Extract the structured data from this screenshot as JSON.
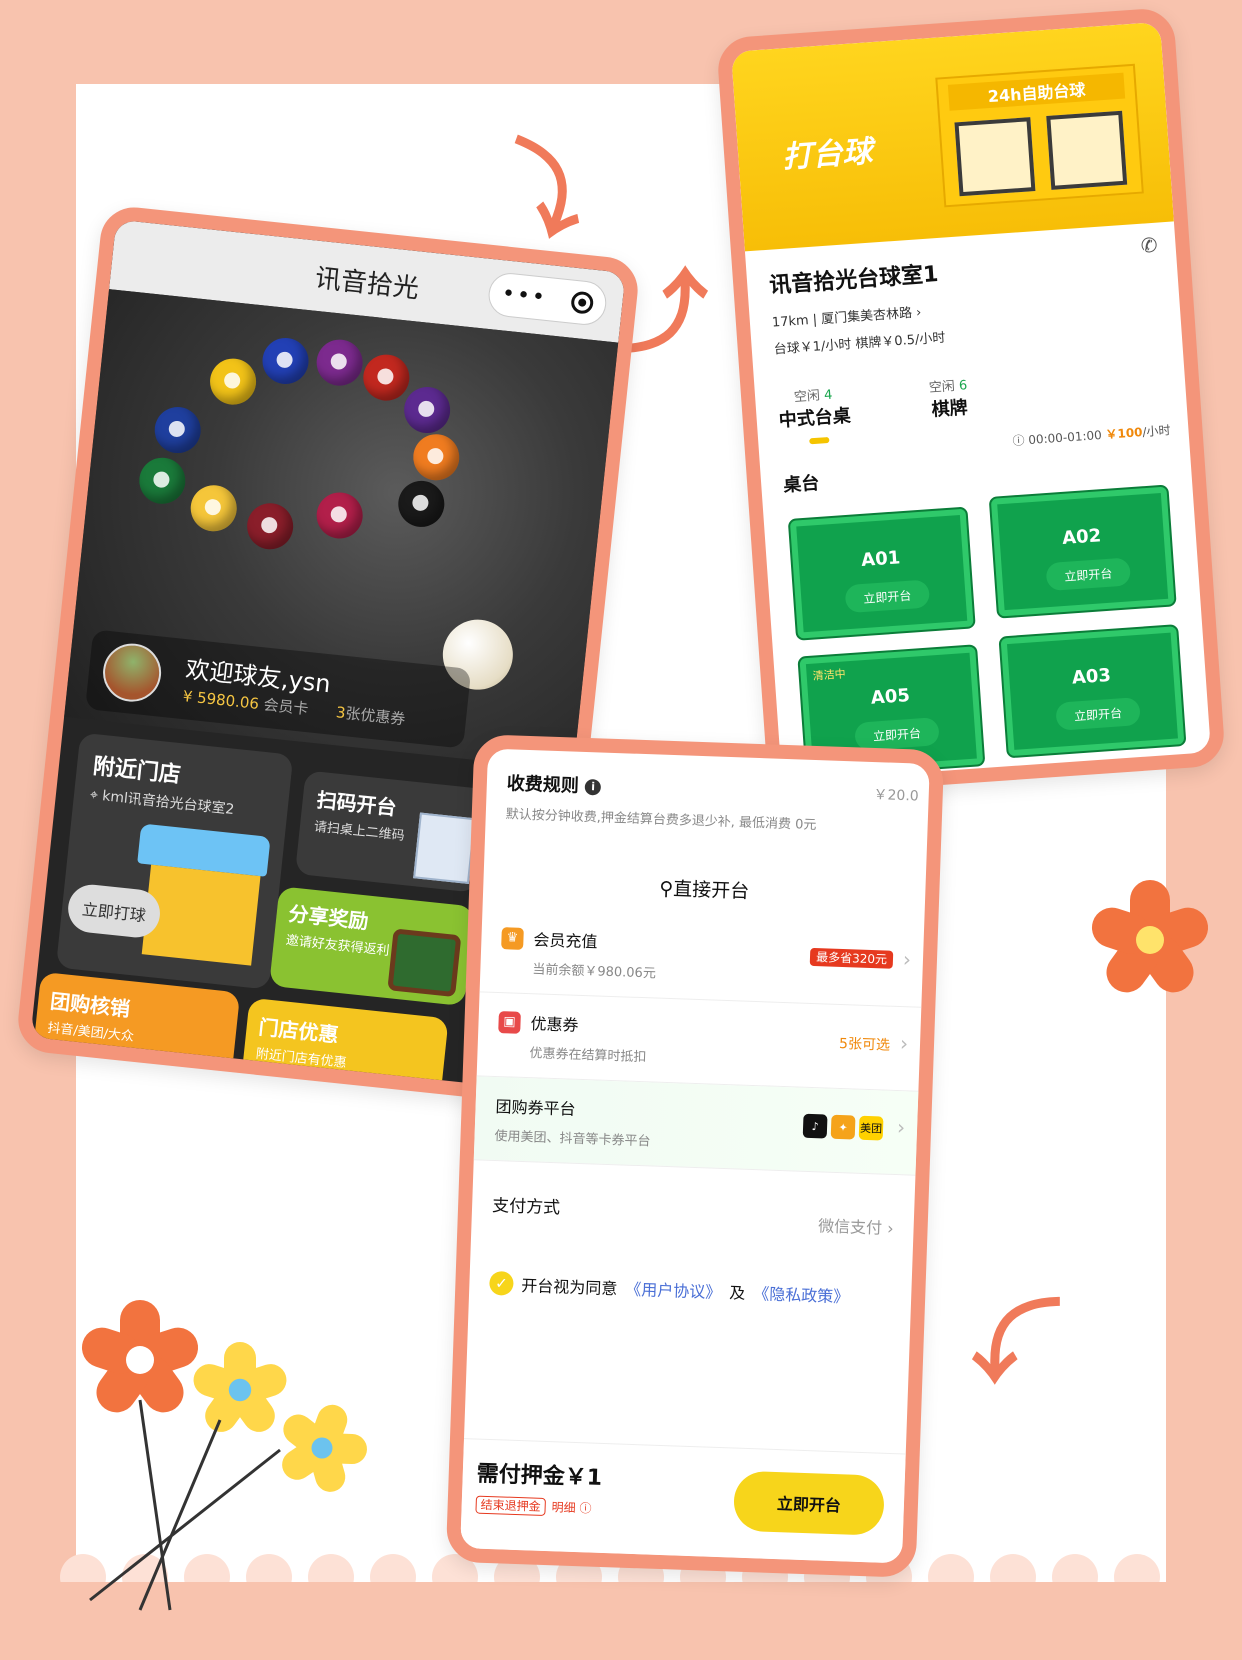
{
  "app_screen": {
    "title": "讯音拾光",
    "welcome": "欢迎球友,ysn",
    "balance": "¥ 5980.06",
    "member_card": "会员卡",
    "coupon_count": "3",
    "coupon_label": "张优惠券",
    "near_store_title": "附近门店",
    "near_store_name": "kml讯音拾光台球室2",
    "play_now": "立即打球",
    "scan_title": "扫码开台",
    "scan_sub": "请扫桌上二维码",
    "share_title": "分享奖励",
    "share_sub": "邀请好友获得返利",
    "group_title": "团购核销",
    "group_sub": "抖音/美团/大众",
    "store_offer_title": "门店优惠",
    "store_offer_sub": "附近门店有优惠"
  },
  "store_screen": {
    "banner_text": "打台球",
    "sign_text": "24h自助台球",
    "store_name": "讯音拾光台球室1",
    "address": "17km | 厦门集美杏林路",
    "price_line": "台球￥1/小时 棋牌￥0.5/小时",
    "tabs": [
      {
        "free_label": "空闲",
        "free_count": "4",
        "name": "中式台桌"
      },
      {
        "free_label": "空闲",
        "free_count": "6",
        "name": "棋牌"
      }
    ],
    "hours": "00:00-01:00",
    "hour_price": "￥100",
    "per_hour": "/小时",
    "section_label": "桌台",
    "tables": [
      {
        "id": "A01",
        "action": "立即开台",
        "status": ""
      },
      {
        "id": "A02",
        "action": "立即开台",
        "status": ""
      },
      {
        "id": "A05",
        "action": "立即开台",
        "status": "清洁中"
      },
      {
        "id": "A03",
        "action": "立即开台",
        "status": ""
      }
    ]
  },
  "pay_screen": {
    "rule_title": "收费规则",
    "rule_price": "￥20.0",
    "rule_desc": "默认按分钟收费,押金结算台费多退少补, 最低消费 0元",
    "direct_open": "直接开台",
    "member_recharge": "会员充值",
    "member_balance": "当前余额￥980.06元",
    "member_badge": "最多省320元",
    "coupon": "优惠券",
    "coupon_sub": "优惠券在结算时抵扣",
    "coupon_right": "5张可选",
    "platform": "团购券平台",
    "platform_sub": "使用美团、抖音等卡券平台",
    "platform_meituan": "美团",
    "pay_method": "支付方式",
    "pay_value": "微信支付",
    "agree_prefix": "开台视为同意",
    "agreement": "《用户协议》",
    "and": "及",
    "privacy": "《隐私政策》",
    "deposit": "需付押金￥1",
    "refund_tag": "结束退押金",
    "detail": "明细",
    "open_button": "立即开台"
  },
  "colors": {
    "frame": "#f4957a",
    "yellow": "#f7d51b",
    "green": "#10a24d",
    "background": "#f8c3ae"
  }
}
